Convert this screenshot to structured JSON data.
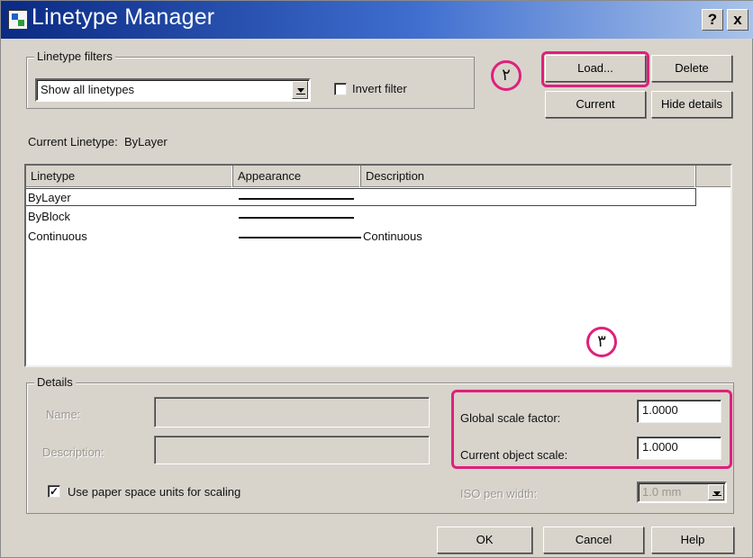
{
  "window": {
    "title": "Linetype Manager",
    "help_btn": "?",
    "close_btn": "x"
  },
  "filters": {
    "group_label": "Linetype filters",
    "selected": "Show all linetypes",
    "invert_label": "Invert filter",
    "invert_checked": false
  },
  "buttons": {
    "load": "Load...",
    "delete": "Delete",
    "current": "Current",
    "hide_details": "Hide details",
    "ok": "OK",
    "cancel": "Cancel",
    "help": "Help"
  },
  "current_linetype": {
    "label": "Current Linetype:",
    "value": "ByLayer"
  },
  "table": {
    "columns": [
      "Linetype",
      "Appearance",
      "Description"
    ],
    "rows": [
      {
        "linetype": "ByLayer",
        "description": "",
        "selected": true
      },
      {
        "linetype": "ByBlock",
        "description": "",
        "selected": false
      },
      {
        "linetype": "Continuous",
        "description": "Continuous",
        "selected": false
      }
    ]
  },
  "details": {
    "group_label": "Details",
    "name_label": "Name:",
    "description_label": "Description:",
    "paper_space_label": "Use paper space units for scaling",
    "paper_space_checked": true,
    "global_scale_label": "Global scale factor:",
    "global_scale_value": "1.0000",
    "object_scale_label": "Current object scale:",
    "object_scale_value": "1.0000",
    "iso_pen_label": "ISO pen width:",
    "iso_pen_value": "1.0 mm"
  },
  "annotations": {
    "marker_2": "۲",
    "marker_3": "۳",
    "highlight_color": "#e0207c"
  }
}
